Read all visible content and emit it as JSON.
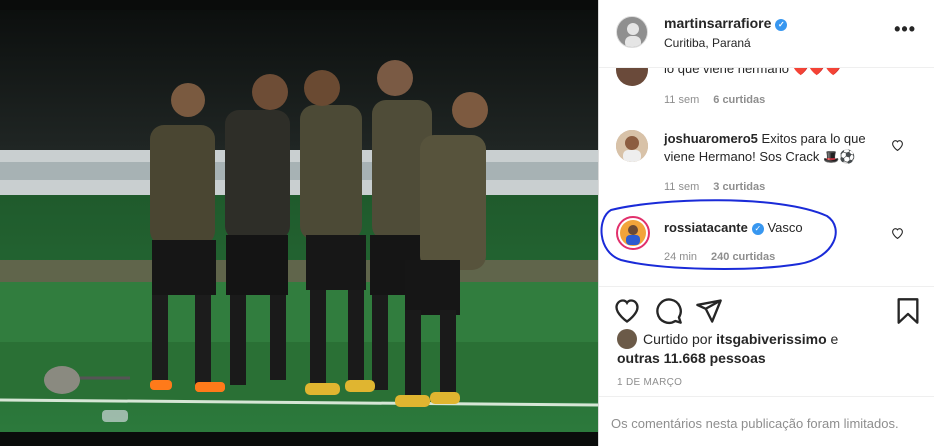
{
  "post": {
    "image_alt": "Soccer players celebrating on the field at night",
    "author": {
      "username": "martinsarrafiore",
      "location": "Curitiba, Paraná",
      "verified": true
    },
    "more_icon": "more-options-icon",
    "comments": [
      {
        "username": "",
        "text": "lo que viene hermano ❤️❤️❤️",
        "time": "11 sem",
        "likes": "6 curtidas"
      },
      {
        "username": "joshuaromero5",
        "text": "Exitos para lo que viene Hermano! Sos Crack 🎩⚽",
        "time": "11 sem",
        "likes": "3 curtidas"
      },
      {
        "username": "rossiatacante",
        "verified": true,
        "text": "Vasco",
        "time": "24 min",
        "likes": "240 curtidas"
      }
    ],
    "actions": [
      "heart-icon",
      "comment-icon",
      "share-icon",
      "bookmark-icon"
    ],
    "liked_by": {
      "prefix": "Curtido por",
      "user": "itsgabiverissimo",
      "connector": "e",
      "others": "outras 11.668 pessoas"
    },
    "date": "1 DE MARÇO",
    "comments_limited": "Os comentários nesta publicação foram limitados."
  },
  "colors": {
    "verified": "#3897f0",
    "annotation": "#1a2bd8",
    "muted": "#8e8e8e",
    "text": "#262626"
  }
}
